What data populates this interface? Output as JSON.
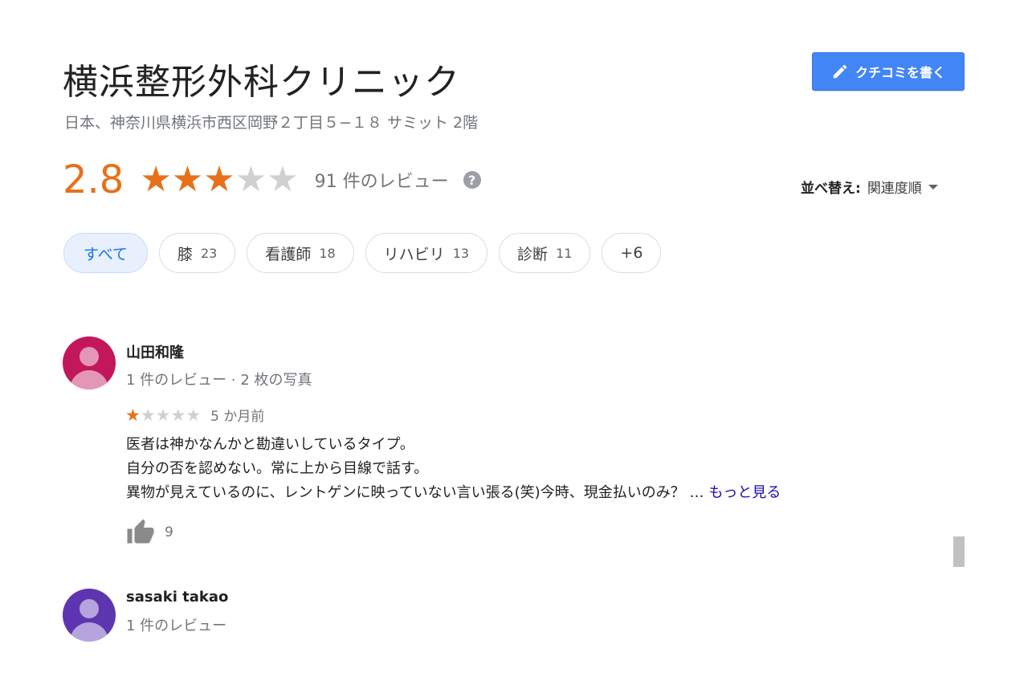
{
  "place": {
    "title": "横浜整形外科クリニック",
    "address": "日本、神奈川県横浜市西区岡野２丁目５−１８ サミット 2階"
  },
  "write_review_button": {
    "label": "クチコミを書く"
  },
  "rating": {
    "value": "2.8",
    "stars_filled": 3,
    "stars_total": 5,
    "review_count_label": "91 件のレビュー"
  },
  "sort": {
    "label": "並べ替え:",
    "value": "関連度順"
  },
  "chips": [
    {
      "label": "すべて",
      "count": "",
      "active": true
    },
    {
      "label": "膝",
      "count": "23",
      "active": false
    },
    {
      "label": "看護師",
      "count": "18",
      "active": false
    },
    {
      "label": "リハビリ",
      "count": "13",
      "active": false
    },
    {
      "label": "診断",
      "count": "11",
      "active": false
    },
    {
      "label": "+6",
      "count": "",
      "active": false
    }
  ],
  "reviews": [
    {
      "name": "山田和隆",
      "meta": "1 件のレビュー · 2 枚の写真",
      "avatar_color": "#c2185b",
      "stars": 1,
      "time": "5 か月前",
      "lines": [
        "医者は神かなんかと勘違いしているタイプ。",
        "自分の否を認めない。常に上から目線で話す。",
        "異物が見えているのに、レントゲンに映っていない言い張る(笑)今時、現金払いのみ？"
      ],
      "ellipsis": "…",
      "more_label": "もっと見る",
      "likes": "9"
    },
    {
      "name": "sasaki takao",
      "meta": "1 件のレビュー",
      "avatar_color": "#5e35b1"
    }
  ],
  "colors": {
    "accent_orange": "#e7711b",
    "button_blue": "#4285f4",
    "link_blue": "#1a0dab"
  }
}
